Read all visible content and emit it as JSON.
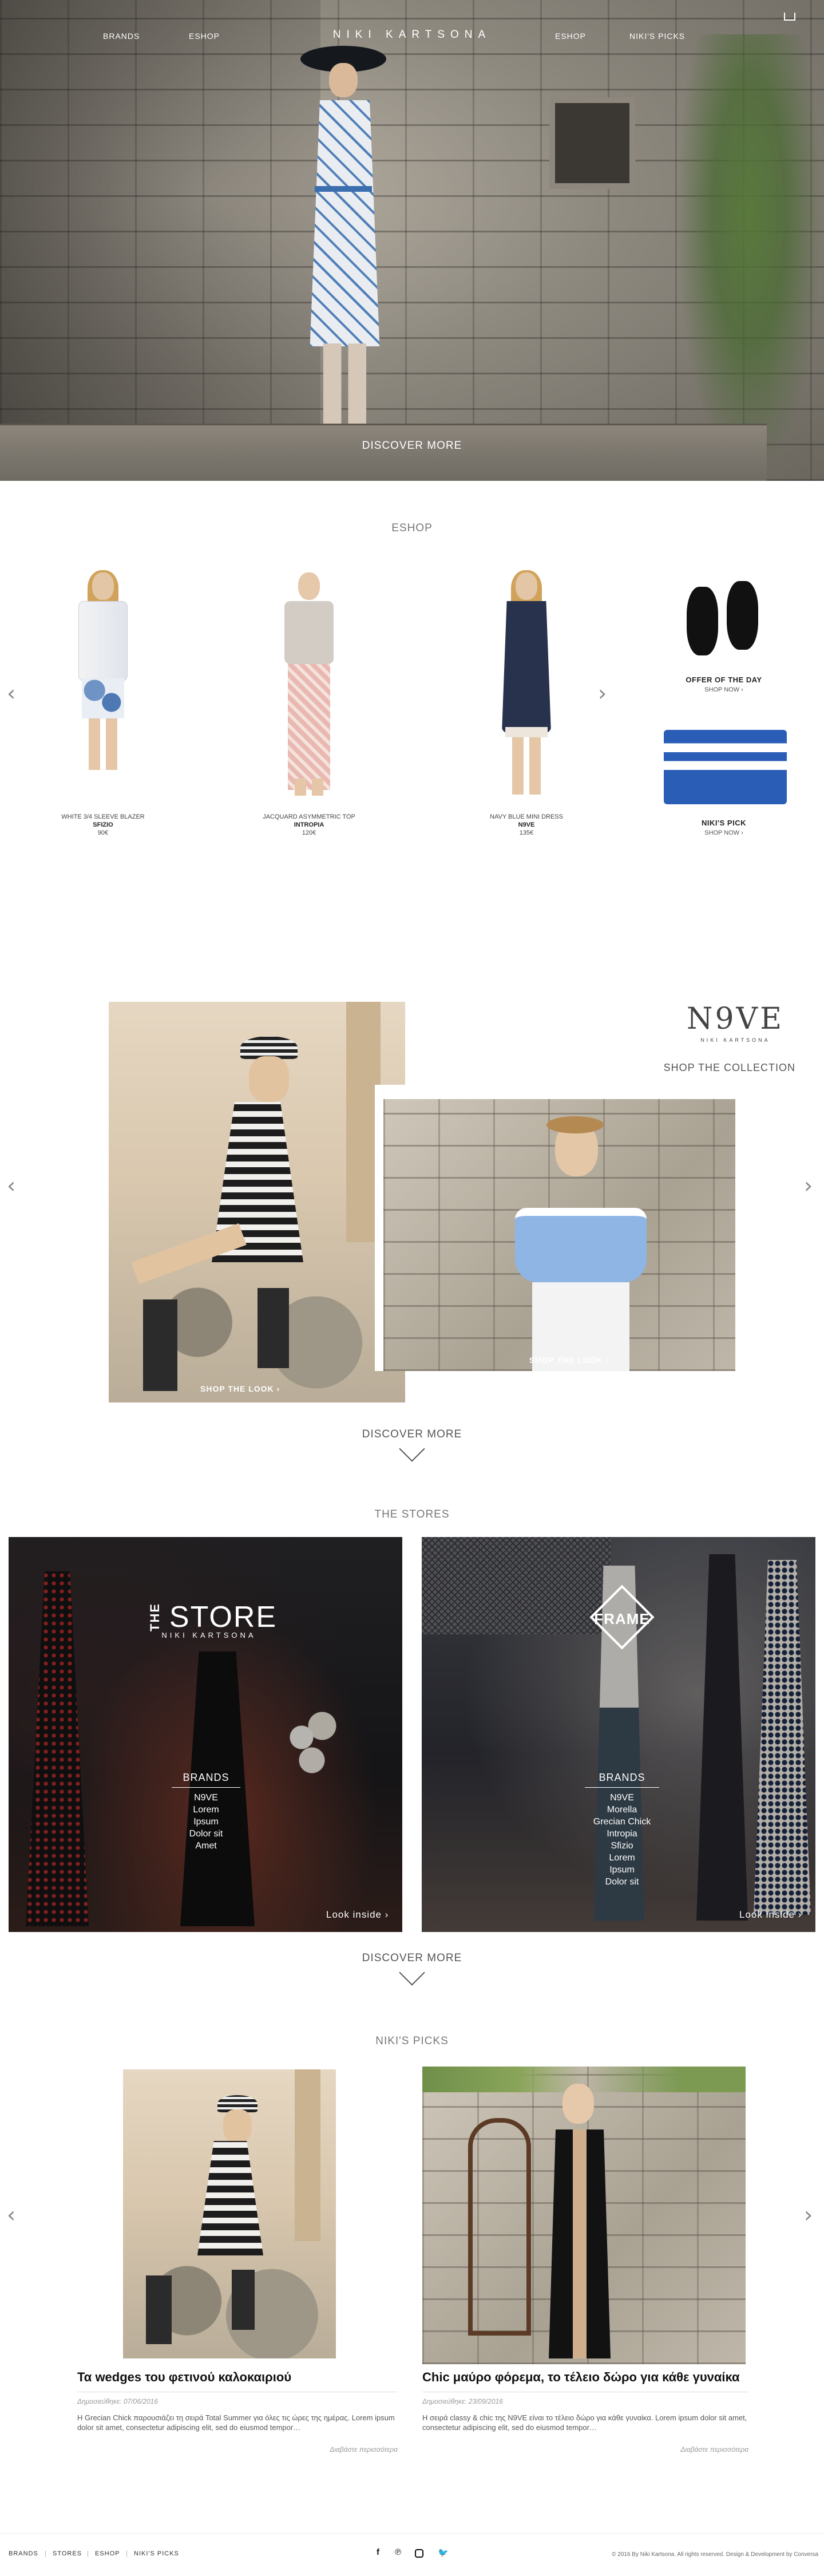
{
  "nav": {
    "left": [
      "BRANDS",
      "ESHOP"
    ],
    "logo": "NIKI KARTSONA",
    "right": [
      "ESHOP",
      "NIKI'S PICKS"
    ]
  },
  "hero": {
    "discover": "DISCOVER MORE"
  },
  "eshop": {
    "title": "ESHOP",
    "products": [
      {
        "name": "WHITE 3/4 SLEEVE BLAZER",
        "brand": "SFIZIO",
        "price": "90€"
      },
      {
        "name": "JACQUARD ASYMMETRIC TOP",
        "brand": "INTROPIA",
        "price": "120€"
      },
      {
        "name": "NAVY BLUE MINI DRESS",
        "brand": "N9VE",
        "price": "135€"
      }
    ],
    "offer": {
      "label": "OFFER OF THE DAY",
      "link": "SHOP NOW"
    },
    "pick": {
      "label": "NIKI'S PICK",
      "link": "SHOP NOW"
    }
  },
  "collection": {
    "logo": "N9VE",
    "logo_sub": "NIKI KARTSONA",
    "shop_collection": "SHOP THE COLLECTION",
    "shop_look_1": "SHOP THE LOOK",
    "shop_look_2": "SHOP THE LOOK",
    "discover": "DISCOVER MORE"
  },
  "stores": {
    "title": "THE STORES",
    "store1": {
      "logo_the": "THE",
      "logo_store": "STORE",
      "logo_sub": "NIKI KARTSONA",
      "brands_title": "BRANDS",
      "brands": [
        "N9VE",
        "Lorem",
        "Ipsum",
        "Dolor sit",
        "Amet"
      ],
      "look": "Look inside"
    },
    "store2": {
      "logo": "FRAME",
      "brands_title": "BRANDS",
      "brands": [
        "N9VE",
        "Morella",
        "Grecian Chick",
        "Intropia",
        "Sfizio",
        "Lorem",
        "Ipsum",
        "Dolor sit"
      ],
      "look": "Look inside"
    },
    "discover": "DISCOVER MORE"
  },
  "picks": {
    "title": "NIKI'S PICKS",
    "items": [
      {
        "title": "Τα wedges του φετινού καλοκαιριού",
        "date": "Δημοσιεύθηκε: 07/06/2016",
        "text": "Η Grecian Chick παρουσιάζει τη σειρά Total Summer για όλες τις ώρες της ημέρας. Lorem ipsum dolor sit amet, consectetur adipiscing elit, sed do eiusmod tempor…",
        "more": "Διαβάστε περισσότερα"
      },
      {
        "title": "Chic μαύρο φόρεμα, το τέλειο δώρο για κάθε γυναίκα",
        "date": "Δημοσιεύθηκε: 23/09/2016",
        "text": "Η σειρά classy & chic της N9VE είναι το τέλειο δώρο για κάθε γυναίκα. Lorem ipsum dolor sit amet, consectetur adipiscing elit, sed do eiusmod tempor…",
        "more": "Διαβάστε περισσότερα"
      }
    ]
  },
  "footer": {
    "links": [
      "BRANDS",
      "STORES",
      "ESHOP",
      "NIKI'S PICKS"
    ],
    "copyright": "© 2016 By Niki Kartsona. All rights reserved. Design & Development by Conversa"
  },
  "icons": {
    "arrow_left": "‹",
    "arrow_right": "›",
    "social": [
      "facebook-icon",
      "pinterest-icon",
      "instagram-icon",
      "twitter-icon"
    ]
  }
}
